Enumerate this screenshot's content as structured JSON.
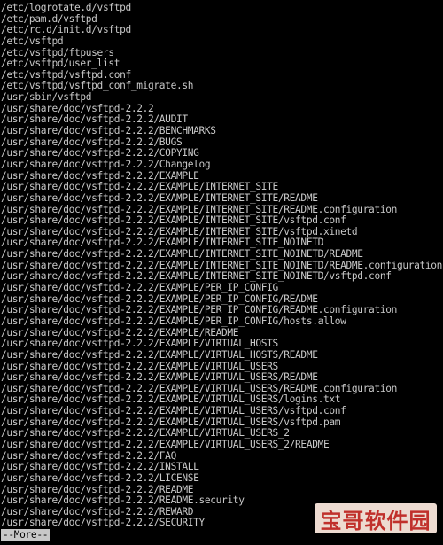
{
  "terminal": {
    "background": "#000000",
    "text_color": "#c8c8c8",
    "lines": [
      "/etc/logrotate.d/vsftpd",
      "/etc/pam.d/vsftpd",
      "/etc/rc.d/init.d/vsftpd",
      "/etc/vsftpd",
      "/etc/vsftpd/ftpusers",
      "/etc/vsftpd/user_list",
      "/etc/vsftpd/vsftpd.conf",
      "/etc/vsftpd/vsftpd_conf_migrate.sh",
      "/usr/sbin/vsftpd",
      "/usr/share/doc/vsftpd-2.2.2",
      "/usr/share/doc/vsftpd-2.2.2/AUDIT",
      "/usr/share/doc/vsftpd-2.2.2/BENCHMARKS",
      "/usr/share/doc/vsftpd-2.2.2/BUGS",
      "/usr/share/doc/vsftpd-2.2.2/COPYING",
      "/usr/share/doc/vsftpd-2.2.2/Changelog",
      "/usr/share/doc/vsftpd-2.2.2/EXAMPLE",
      "/usr/share/doc/vsftpd-2.2.2/EXAMPLE/INTERNET_SITE",
      "/usr/share/doc/vsftpd-2.2.2/EXAMPLE/INTERNET_SITE/README",
      "/usr/share/doc/vsftpd-2.2.2/EXAMPLE/INTERNET_SITE/README.configuration",
      "/usr/share/doc/vsftpd-2.2.2/EXAMPLE/INTERNET_SITE/vsftpd.conf",
      "/usr/share/doc/vsftpd-2.2.2/EXAMPLE/INTERNET_SITE/vsftpd.xinetd",
      "/usr/share/doc/vsftpd-2.2.2/EXAMPLE/INTERNET_SITE_NOINETD",
      "/usr/share/doc/vsftpd-2.2.2/EXAMPLE/INTERNET_SITE_NOINETD/README",
      "/usr/share/doc/vsftpd-2.2.2/EXAMPLE/INTERNET_SITE_NOINETD/README.configuration",
      "/usr/share/doc/vsftpd-2.2.2/EXAMPLE/INTERNET_SITE_NOINETD/vsftpd.conf",
      "/usr/share/doc/vsftpd-2.2.2/EXAMPLE/PER_IP_CONFIG",
      "/usr/share/doc/vsftpd-2.2.2/EXAMPLE/PER_IP_CONFIG/README",
      "/usr/share/doc/vsftpd-2.2.2/EXAMPLE/PER_IP_CONFIG/README.configuration",
      "/usr/share/doc/vsftpd-2.2.2/EXAMPLE/PER_IP_CONFIG/hosts.allow",
      "/usr/share/doc/vsftpd-2.2.2/EXAMPLE/README",
      "/usr/share/doc/vsftpd-2.2.2/EXAMPLE/VIRTUAL_HOSTS",
      "/usr/share/doc/vsftpd-2.2.2/EXAMPLE/VIRTUAL_HOSTS/README",
      "/usr/share/doc/vsftpd-2.2.2/EXAMPLE/VIRTUAL_USERS",
      "/usr/share/doc/vsftpd-2.2.2/EXAMPLE/VIRTUAL_USERS/README",
      "/usr/share/doc/vsftpd-2.2.2/EXAMPLE/VIRTUAL_USERS/README.configuration",
      "/usr/share/doc/vsftpd-2.2.2/EXAMPLE/VIRTUAL_USERS/logins.txt",
      "/usr/share/doc/vsftpd-2.2.2/EXAMPLE/VIRTUAL_USERS/vsftpd.conf",
      "/usr/share/doc/vsftpd-2.2.2/EXAMPLE/VIRTUAL_USERS/vsftpd.pam",
      "/usr/share/doc/vsftpd-2.2.2/EXAMPLE/VIRTUAL_USERS_2",
      "/usr/share/doc/vsftpd-2.2.2/EXAMPLE/VIRTUAL_USERS_2/README",
      "/usr/share/doc/vsftpd-2.2.2/FAQ",
      "/usr/share/doc/vsftpd-2.2.2/INSTALL",
      "/usr/share/doc/vsftpd-2.2.2/LICENSE",
      "/usr/share/doc/vsftpd-2.2.2/README",
      "/usr/share/doc/vsftpd-2.2.2/README.security",
      "/usr/share/doc/vsftpd-2.2.2/REWARD",
      "/usr/share/doc/vsftpd-2.2.2/SECURITY"
    ],
    "pager_prompt": "--More--"
  },
  "watermark": {
    "text": "宝哥软件园",
    "color": "#c0302b"
  }
}
